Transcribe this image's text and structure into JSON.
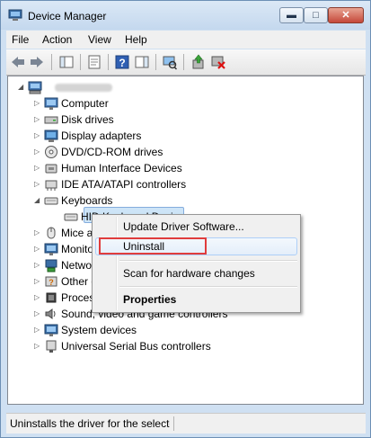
{
  "window": {
    "title": "Device Manager"
  },
  "menu": [
    "File",
    "Action",
    "View",
    "Help"
  ],
  "tree": [
    {
      "label": "",
      "kind": "computer",
      "expander": "open",
      "level": 0,
      "blurred": true
    },
    {
      "label": "Computer",
      "kind": "monitor",
      "expander": "closed",
      "level": 1
    },
    {
      "label": "Disk drives",
      "kind": "disk",
      "expander": "closed",
      "level": 1
    },
    {
      "label": "Display adapters",
      "kind": "display",
      "expander": "closed",
      "level": 1
    },
    {
      "label": "DVD/CD-ROM drives",
      "kind": "dvd",
      "expander": "closed",
      "level": 1
    },
    {
      "label": "Human Interface Devices",
      "kind": "hid",
      "expander": "closed",
      "level": 1
    },
    {
      "label": "IDE ATA/ATAPI controllers",
      "kind": "ide",
      "expander": "closed",
      "level": 1
    },
    {
      "label": "Keyboards",
      "kind": "keyboard",
      "expander": "open",
      "level": 1
    },
    {
      "label": "HID Keyboard Device",
      "kind": "keyboard",
      "expander": "none",
      "level": 2,
      "selected": true
    },
    {
      "label": "Mice and other pointing devices",
      "kind": "mouse",
      "expander": "closed",
      "level": 1
    },
    {
      "label": "Monitors",
      "kind": "monitor",
      "expander": "closed",
      "level": 1
    },
    {
      "label": "Network adapters",
      "kind": "network",
      "expander": "closed",
      "level": 1
    },
    {
      "label": "Other devices",
      "kind": "other",
      "expander": "closed",
      "level": 1
    },
    {
      "label": "Processors",
      "kind": "processor",
      "expander": "closed",
      "level": 1
    },
    {
      "label": "Sound, video and game controllers",
      "kind": "sound",
      "expander": "closed",
      "level": 1
    },
    {
      "label": "System devices",
      "kind": "system",
      "expander": "closed",
      "level": 1
    },
    {
      "label": "Universal Serial Bus controllers",
      "kind": "usb",
      "expander": "closed",
      "level": 1
    }
  ],
  "context_menu": {
    "update": "Update Driver Software...",
    "uninstall": "Uninstall",
    "scan": "Scan for hardware changes",
    "properties": "Properties"
  },
  "status": {
    "text": "Uninstalls the driver for the selected device."
  },
  "colors": {
    "highlight_box": "#e03c3c",
    "selection": "#cde4f7"
  }
}
